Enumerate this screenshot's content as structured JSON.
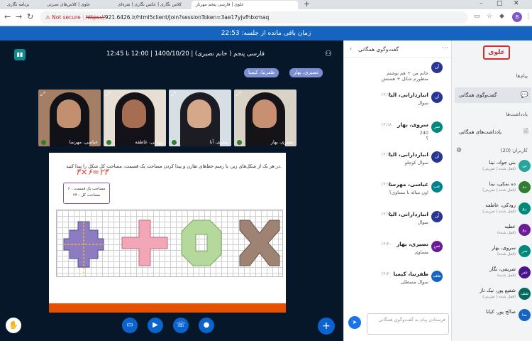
{
  "browser": {
    "tabs": [
      {
        "label": "برنامه نگاری"
      },
      {
        "label": "علوی | کلاس‌های نصرتی"
      },
      {
        "label": "کلاس نگاری | عکس نگاری | نفره‌ای"
      },
      {
        "label": "علوی | فارسی پنجم مهرناز"
      }
    ],
    "new_tab": "+",
    "security_label": "Not secure",
    "url_scheme": "https://",
    "url_rest": "921.6426.ir/html5client/join?sessionToken=3ae17yjvfhbxmaq",
    "profile_initial": "B"
  },
  "timer": {
    "label": "زمان باقی مانده از جلسه:",
    "value": "22:53"
  },
  "stage": {
    "title": "فارسی پنجم ( خانم نصیری) | 1400/10/20 | 12:00 تا 12:45",
    "presenters": [
      "نصیری، بهار",
      "ظفرنیا، کیمیا"
    ],
    "cameras": [
      {
        "name": "عباسی، مهرسا",
        "bg": "#a57e66",
        "hijab": "#111217",
        "face": "#c2906f"
      },
      {
        "name": "رودکی، عاطفه",
        "bg": "#e8dfd4",
        "hijab": "#121218",
        "face": "#a66d52"
      },
      {
        "name": "پنجری، آنا",
        "bg": "#d8dfe4",
        "hijab": "#1c1c25",
        "face": "#d6a88a"
      },
      {
        "name": "نصیری، بهار",
        "bg": "#d9d2c7",
        "hijab": "#141418",
        "face": "#c88f72"
      }
    ],
    "slide": {
      "question": "در هر یک از شکل‌های زیر، با رسم خط‌های تقارن و پیدا کردن مساحت یک قسمت، مساحت کل شکل را پیدا کنید.",
      "handwriting": "۴×۶=۲۴",
      "note_line1": "مساحت یک قسمت : ۶",
      "note_line2": "مساحت کل : ۲۴"
    }
  },
  "controls": {
    "raise_hand": "✋",
    "screen": "▭",
    "video": "▶",
    "phone": "☏",
    "mic": "●",
    "more": "+"
  },
  "chat": {
    "title": "گفت‌وگوی همگانی",
    "messages": [
      {
        "name": "",
        "time": "",
        "text": "خانم من + هم نوشتم\nمنظورم شکل + هستش",
        "avatar": "آن",
        "color": "#283593"
      },
      {
        "name": "انباردارانی، الیا",
        "time": "۱۲:۱۸",
        "text": "سوال",
        "avatar": "آن",
        "color": "#283593"
      },
      {
        "name": "سروی، بهار",
        "time": "۱۲:۱۸",
        "text": "240\n؟",
        "avatar": "سر",
        "color": "#00897b"
      },
      {
        "name": "انباردارانی، الیا",
        "time": "۱۲:۱۸",
        "text": "سوال کوچلو",
        "avatar": "آن",
        "color": "#283593"
      },
      {
        "name": "عباسی، مهرسا",
        "time": "۱۲:۱۹",
        "text": "اون میاله با مساوی؟",
        "avatar": "عب",
        "color": "#00838f"
      },
      {
        "name": "انباردارانی، الیا",
        "time": "۱۲:۱۹",
        "text": "سوال",
        "avatar": "آن",
        "color": "#283593"
      },
      {
        "name": "نصیری، بهار",
        "time": "۱۲:۲۰",
        "text": "مساوی",
        "avatar": "نص",
        "color": "#6a1b9a"
      },
      {
        "name": "ظفرنیا، کیمیا",
        "time": "۱۲:۲۰",
        "text": "سوال مسطلی",
        "avatar": "ظف",
        "color": "#1565c0"
      }
    ],
    "input_placeholder": "فرستادن پیام به گفت‌وگوی همگانی",
    "send": "➤"
  },
  "side": {
    "logo": "علوی",
    "messages_label": "پیام‌ها",
    "public_chat": "گفت‌وگوی همگانی",
    "notes_label": "یادداشت‌ها",
    "shared_notes": "یادداشت‌های همگانی",
    "users_label": "کاربران (20)",
    "users": [
      {
        "name": "بنی جواد، نینا",
        "status": "(قفل شده | تمرینی)",
        "avatar": "نی",
        "color": "#26a69a"
      },
      {
        "name": "ده نمکی، نینا",
        "status": "(قفل شده | تمرینی)",
        "avatar": "ده",
        "color": "#2e7d32"
      },
      {
        "name": "رودکی، عاطفه",
        "status": "(قفل شده | تمرینی)",
        "avatar": "رو",
        "color": "#00897b"
      },
      {
        "name": "عطیه",
        "status": "(قفل شده)",
        "avatar": "رو",
        "color": "#6a1b9a"
      },
      {
        "name": "سروی، بهار",
        "status": "(قفل شده)",
        "avatar": "سر",
        "color": "#00897b"
      },
      {
        "name": "شریفی، نگار",
        "status": "(قفل شده)",
        "avatar": "شر",
        "color": "#4a148c"
      },
      {
        "name": "شفیع پور، نیک ناز",
        "status": "(قفل شده | تمرینی)",
        "avatar": "شف",
        "color": "#00695c"
      },
      {
        "name": "صالح پور، کیانا",
        "status": "",
        "avatar": "صا",
        "color": "#1565c0"
      }
    ]
  },
  "colors": {
    "accent": "#1565c0",
    "stage_bg": "#06172a",
    "slide_strip": "#e65100"
  }
}
